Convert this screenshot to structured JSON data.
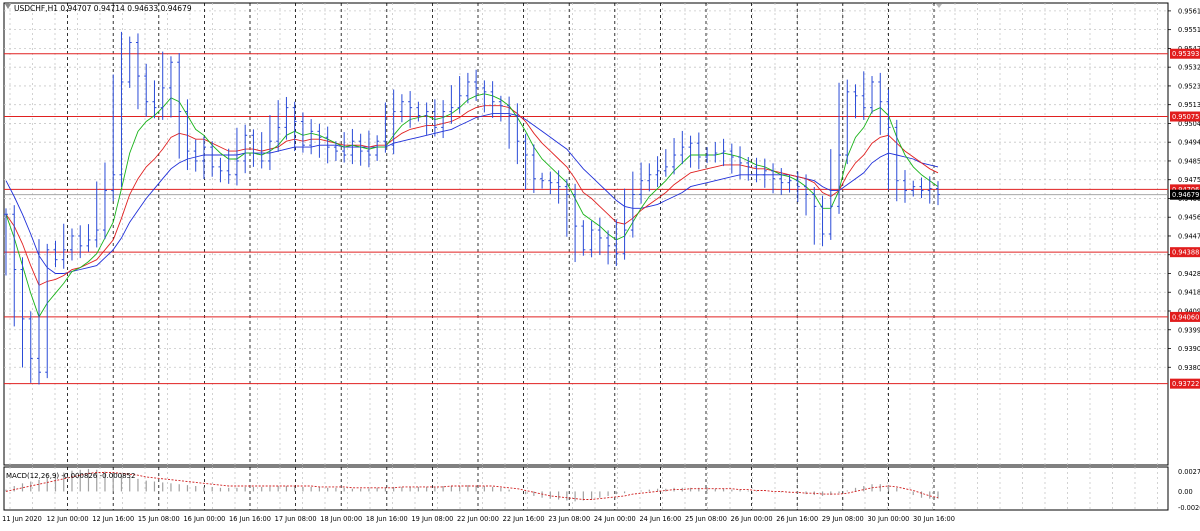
{
  "chart_data": {
    "type": "line",
    "symbol_header": "USDCHF,H1  0.94707 0.94714 0.94633 0.94679",
    "price_axis": {
      "range": [
        0.9331,
        0.9565
      ],
      "ticks": [
        "0.95610",
        "0.95515",
        "0.95420",
        "0.95325",
        "0.95230",
        "0.95135",
        "0.95040",
        "0.94945",
        "0.94850",
        "0.94755",
        "0.94660",
        "0.94565",
        "0.94470",
        "0.94375",
        "0.94280",
        "0.94185",
        "0.94090",
        "0.93995",
        "0.93900",
        "0.93805"
      ]
    },
    "time_axis": {
      "labels": [
        "11 Jun 2020",
        "12 Jun 00:00",
        "12 Jun 16:00",
        "15 Jun 08:00",
        "16 Jun 00:00",
        "16 Jun 16:00",
        "17 Jun 08:00",
        "18 Jun 00:00",
        "18 Jun 16:00",
        "19 Jun 08:00",
        "22 Jun 00:00",
        "22 Jun 16:00",
        "23 Jun 08:00",
        "24 Jun 00:00",
        "24 Jun 16:00",
        "25 Jun 08:00",
        "26 Jun 00:00",
        "26 Jun 16:00",
        "29 Jun 08:00",
        "30 Jun 00:00",
        "30 Jun 16:00"
      ]
    },
    "levels": [
      {
        "value": 0.95393,
        "label": "0.95393"
      },
      {
        "value": 0.95075,
        "label": "0.95075"
      },
      {
        "value": 0.94706,
        "label": "0.94706"
      },
      {
        "value": 0.94388,
        "label": "0.94388"
      },
      {
        "value": 0.9406,
        "label": "0.94060"
      },
      {
        "value": 0.93722,
        "label": "0.93722"
      }
    ],
    "current_price": {
      "value": 0.94679,
      "label": "0.94679"
    },
    "price_series": [
      0.9458,
      0.943,
      0.9405,
      0.9385,
      0.9378,
      0.944,
      0.9435,
      0.944,
      0.9447,
      0.9442,
      0.9445,
      0.945,
      0.947,
      0.9478,
      0.9525,
      0.9545,
      0.9528,
      0.9515,
      0.9512,
      0.9522,
      0.9535,
      0.951,
      0.949,
      0.9485,
      0.9492,
      0.9482,
      0.948,
      0.9478,
      0.9485,
      0.9498,
      0.9489,
      0.9485,
      0.9495,
      0.9502,
      0.9512,
      0.9505,
      0.9493,
      0.95,
      0.9497,
      0.9492,
      0.949,
      0.9488,
      0.9495,
      0.949,
      0.9488,
      0.9495,
      0.9493,
      0.951,
      0.9515,
      0.9512,
      0.9508,
      0.951,
      0.9502,
      0.951,
      0.9512,
      0.9518,
      0.9525,
      0.9522,
      0.952,
      0.9515,
      0.9513,
      0.9508,
      0.9495,
      0.9488,
      0.9476,
      0.9475,
      0.9474,
      0.9472,
      0.9468,
      0.9452,
      0.944,
      0.945,
      0.9446,
      0.9442,
      0.9438,
      0.945,
      0.9468,
      0.9475,
      0.9478,
      0.948,
      0.9482,
      0.9488,
      0.9492,
      0.9494,
      0.9487,
      0.9488,
      0.9489,
      0.949,
      0.9487,
      0.9484,
      0.9482,
      0.9478,
      0.948,
      0.9476,
      0.9474,
      0.9475,
      0.9472,
      0.9468,
      0.9462,
      0.9448,
      0.9462,
      0.9488,
      0.952,
      0.9518,
      0.9512,
      0.9525,
      0.9515,
      0.9502,
      0.9475,
      0.947,
      0.9472,
      0.947,
      0.9471,
      0.9468
    ],
    "ma_green": [
      0.9458,
      0.9446,
      0.9432,
      0.9418,
      0.9406,
      0.9413,
      0.9418,
      0.9423,
      0.9429,
      0.9431,
      0.9434,
      0.9438,
      0.9446,
      0.9454,
      0.9471,
      0.9489,
      0.95,
      0.9505,
      0.9508,
      0.9512,
      0.9517,
      0.9515,
      0.9508,
      0.9501,
      0.9498,
      0.9493,
      0.9489,
      0.9486,
      0.9486,
      0.9489,
      0.9489,
      0.9488,
      0.949,
      0.9493,
      0.9498,
      0.95,
      0.9498,
      0.9499,
      0.9498,
      0.9496,
      0.9494,
      0.9492,
      0.9493,
      0.9492,
      0.9491,
      0.9492,
      0.9492,
      0.9498,
      0.9503,
      0.9506,
      0.9507,
      0.9508,
      0.9506,
      0.9507,
      0.9509,
      0.9512,
      0.9516,
      0.9518,
      0.9519,
      0.9518,
      0.9516,
      0.9513,
      0.9507,
      0.95,
      0.9492,
      0.9486,
      0.9482,
      0.9478,
      0.9474,
      0.9466,
      0.9458,
      0.9455,
      0.9452,
      0.9448,
      0.9445,
      0.9447,
      0.9454,
      0.9461,
      0.9467,
      0.9471,
      0.9475,
      0.948,
      0.9484,
      0.9488,
      0.9488,
      0.9488,
      0.9488,
      0.9489,
      0.9488,
      0.9487,
      0.9485,
      0.9483,
      0.9482,
      0.948,
      0.9478,
      0.9477,
      0.9475,
      0.9472,
      0.9468,
      0.9461,
      0.9461,
      0.947,
      0.9487,
      0.9497,
      0.9502,
      0.951,
      0.9512,
      0.9508,
      0.9497,
      0.9488,
      0.9482,
      0.9478,
      0.9475,
      0.9472
    ],
    "ma_red": [
      0.9458,
      0.9452,
      0.9443,
      0.9432,
      0.9422,
      0.9424,
      0.9425,
      0.9427,
      0.943,
      0.9431,
      0.9433,
      0.9435,
      0.944,
      0.9445,
      0.9456,
      0.9468,
      0.9476,
      0.9482,
      0.9486,
      0.9491,
      0.9497,
      0.9499,
      0.9498,
      0.9496,
      0.9496,
      0.9494,
      0.9492,
      0.949,
      0.949,
      0.9491,
      0.9491,
      0.949,
      0.9491,
      0.9492,
      0.9495,
      0.9496,
      0.9495,
      0.9496,
      0.9496,
      0.9495,
      0.9494,
      0.9493,
      0.9493,
      0.9493,
      0.9492,
      0.9493,
      0.9493,
      0.9496,
      0.9499,
      0.9501,
      0.9502,
      0.9503,
      0.9503,
      0.9504,
      0.9505,
      0.9507,
      0.951,
      0.9512,
      0.9513,
      0.9513,
      0.9513,
      0.9512,
      0.9509,
      0.9505,
      0.9499,
      0.9494,
      0.949,
      0.9486,
      0.9482,
      0.9476,
      0.9469,
      0.9466,
      0.9462,
      0.9458,
      0.9454,
      0.9453,
      0.9456,
      0.946,
      0.9463,
      0.9466,
      0.9469,
      0.9473,
      0.9476,
      0.9479,
      0.948,
      0.9481,
      0.9482,
      0.9483,
      0.9483,
      0.9483,
      0.9482,
      0.9481,
      0.9481,
      0.948,
      0.9479,
      0.9478,
      0.9477,
      0.9476,
      0.9474,
      0.9469,
      0.9467,
      0.947,
      0.9478,
      0.9484,
      0.9488,
      0.9494,
      0.9497,
      0.9498,
      0.9494,
      0.949,
      0.9487,
      0.9484,
      0.9481,
      0.9479
    ],
    "ma_blue": [
      0.9475,
      0.9467,
      0.9458,
      0.9448,
      0.9437,
      0.9431,
      0.9428,
      0.9428,
      0.9429,
      0.943,
      0.9431,
      0.9432,
      0.9436,
      0.944,
      0.9446,
      0.9454,
      0.946,
      0.9466,
      0.9471,
      0.9476,
      0.9481,
      0.9484,
      0.9486,
      0.9487,
      0.9488,
      0.9488,
      0.9488,
      0.9488,
      0.9488,
      0.9489,
      0.9489,
      0.9489,
      0.9489,
      0.949,
      0.9491,
      0.9492,
      0.9492,
      0.9492,
      0.9493,
      0.9493,
      0.9493,
      0.9492,
      0.9492,
      0.9492,
      0.9492,
      0.9492,
      0.9492,
      0.9494,
      0.9495,
      0.9496,
      0.9497,
      0.9498,
      0.9499,
      0.95,
      0.9501,
      0.9503,
      0.9505,
      0.9507,
      0.9508,
      0.9509,
      0.9509,
      0.9509,
      0.9508,
      0.9506,
      0.9503,
      0.95,
      0.9497,
      0.9494,
      0.9491,
      0.9486,
      0.9481,
      0.9477,
      0.9473,
      0.9469,
      0.9465,
      0.9462,
      0.9461,
      0.9461,
      0.9462,
      0.9463,
      0.9465,
      0.9467,
      0.9469,
      0.9472,
      0.9473,
      0.9474,
      0.9475,
      0.9476,
      0.9477,
      0.9478,
      0.9478,
      0.9478,
      0.9478,
      0.9478,
      0.9478,
      0.9478,
      0.9477,
      0.9476,
      0.9475,
      0.9472,
      0.947,
      0.947,
      0.9473,
      0.9476,
      0.9479,
      0.9484,
      0.9487,
      0.9489,
      0.9488,
      0.9487,
      0.9486,
      0.9484,
      0.9483,
      0.9482
    ]
  },
  "macd": {
    "label": "MACD(12,26,9) -0.000826 -0.000852",
    "ticks": [
      "0.002711",
      "0.00",
      "-0.00206"
    ],
    "range": [
      -0.00206,
      0.002711
    ],
    "histogram": [
      0.0002,
      0.0006,
      0.0009,
      0.0011,
      0.0013,
      0.0016,
      0.0019,
      0.0021,
      0.0023,
      0.0024,
      0.0025,
      0.0024,
      0.0022,
      0.002,
      0.0018,
      0.0016,
      0.0014,
      0.0012,
      0.0011,
      0.001,
      0.0009,
      0.0008,
      0.0007,
      0.0006,
      0.0005,
      0.0005,
      0.0004,
      0.0004,
      0.0004,
      0.0005,
      0.0005,
      0.0005,
      0.0005,
      0.0006,
      0.0006,
      0.0006,
      0.0005,
      0.0005,
      0.0005,
      0.0004,
      0.0004,
      0.0004,
      0.0003,
      0.0003,
      0.0003,
      0.0004,
      0.0004,
      0.0005,
      0.0005,
      0.0005,
      0.0005,
      0.0005,
      0.0005,
      0.0006,
      0.0006,
      0.0006,
      0.0007,
      0.0006,
      0.0006,
      0.0005,
      0.0004,
      0.0002,
      0.0,
      -0.0003,
      -0.0005,
      -0.0007,
      -0.0008,
      -0.0009,
      -0.001,
      -0.0011,
      -0.001,
      -0.0009,
      -0.0007,
      -0.0005,
      -0.0003,
      -0.0002,
      0.0,
      0.0001,
      0.0002,
      0.0003,
      0.0003,
      0.0004,
      0.0004,
      0.0004,
      0.0004,
      0.0004,
      0.0003,
      0.0003,
      0.0002,
      0.0002,
      0.0001,
      0.0001,
      0.0,
      0.0,
      -0.0001,
      -0.0001,
      -0.0002,
      -0.0003,
      -0.0004,
      -0.0005,
      -0.0004,
      -0.0002,
      0.0001,
      0.0004,
      0.0006,
      0.0008,
      0.0008,
      0.0007,
      0.0004,
      0.0,
      -0.0004,
      -0.0007,
      -0.0008,
      -0.0008
    ],
    "signal": [
      0.0,
      0.0002,
      0.0004,
      0.0006,
      0.0008,
      0.001,
      0.0012,
      0.0014,
      0.0016,
      0.0018,
      0.002,
      0.0021,
      0.0021,
      0.0021,
      0.002,
      0.0019,
      0.0018,
      0.0016,
      0.0015,
      0.0014,
      0.0013,
      0.0012,
      0.0011,
      0.001,
      0.0009,
      0.0008,
      0.0007,
      0.0006,
      0.0006,
      0.0006,
      0.0006,
      0.0006,
      0.0006,
      0.0006,
      0.0006,
      0.0006,
      0.0006,
      0.0006,
      0.0005,
      0.0005,
      0.0005,
      0.0005,
      0.0004,
      0.0004,
      0.0004,
      0.0004,
      0.0004,
      0.0004,
      0.0005,
      0.0005,
      0.0005,
      0.0005,
      0.0005,
      0.0005,
      0.0006,
      0.0006,
      0.0006,
      0.0006,
      0.0006,
      0.0006,
      0.0005,
      0.0004,
      0.0003,
      0.0001,
      -0.0001,
      -0.0003,
      -0.0005,
      -0.0006,
      -0.0007,
      -0.0008,
      -0.0009,
      -0.0009,
      -0.0008,
      -0.0007,
      -0.0006,
      -0.0005,
      -0.0003,
      -0.0002,
      -0.0001,
      0.0,
      0.0001,
      0.0002,
      0.0002,
      0.0003,
      0.0003,
      0.0003,
      0.0003,
      0.0003,
      0.0003,
      0.0002,
      0.0002,
      0.0001,
      0.0001,
      0.0,
      0.0,
      -0.0001,
      -0.0001,
      -0.0002,
      -0.0002,
      -0.0003,
      -0.0003,
      -0.0003,
      -0.0002,
      0.0,
      0.0002,
      0.0004,
      0.0005,
      0.0006,
      0.0005,
      0.0003,
      0.0001,
      -0.0002,
      -0.0005,
      -0.0007
    ]
  },
  "colors": {
    "price": "#2a4bd7",
    "ma_green": "#19b319",
    "ma_red": "#e02020",
    "ma_blue": "#1f2fd9",
    "level_line": "#e02020",
    "level_label_bg": "#e11d1d",
    "current_label_bg": "#000000",
    "grid": "#c8c8c8",
    "vgrid": "#000000",
    "macd_hist": "#a0a0a0",
    "macd_signal": "#d02020"
  }
}
